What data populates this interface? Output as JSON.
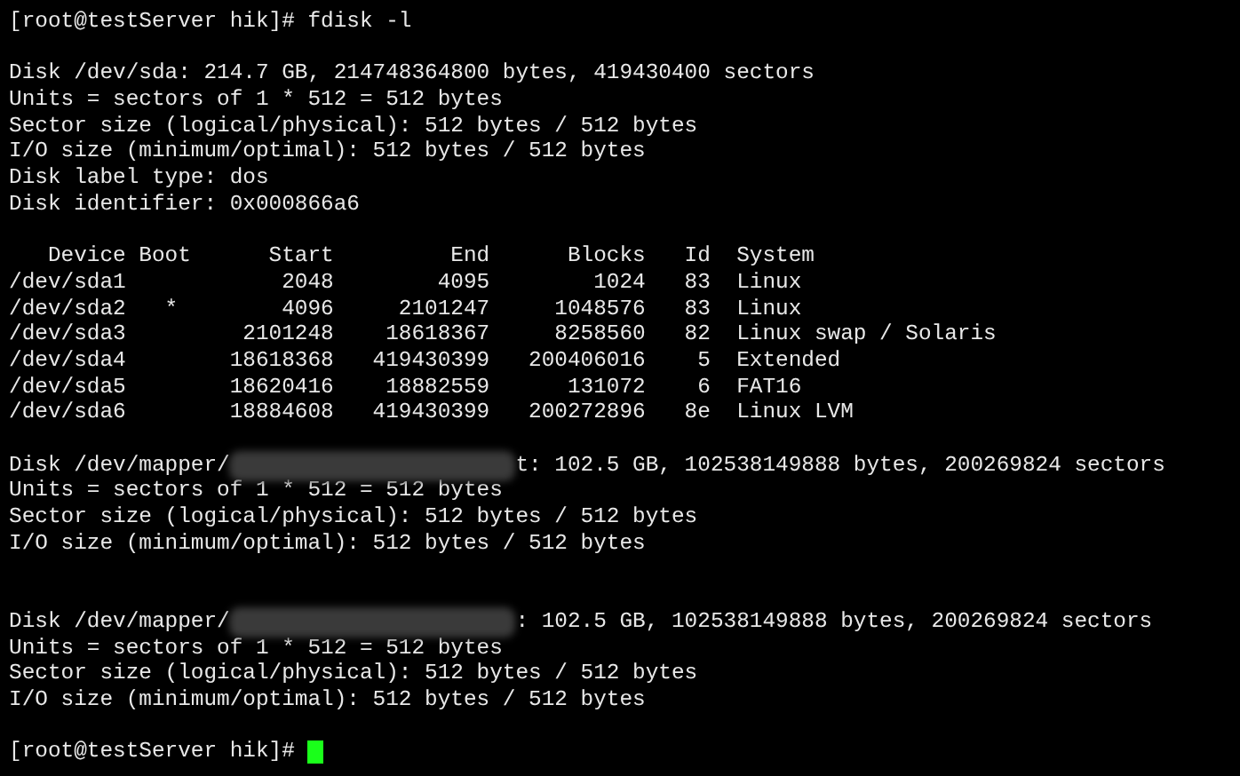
{
  "terminal": {
    "lines": [
      {
        "kind": "prompt",
        "prompt": "[root@testServer hik]#",
        "command": "fdisk -l"
      },
      {
        "kind": "blank"
      },
      {
        "kind": "text",
        "text": "Disk /dev/sda: 214.7 GB, 214748364800 bytes, 419430400 sectors"
      },
      {
        "kind": "text",
        "text": "Units = sectors of 1 * 512 = 512 bytes"
      },
      {
        "kind": "text",
        "text": "Sector size (logical/physical): 512 bytes / 512 bytes"
      },
      {
        "kind": "text",
        "text": "I/O size (minimum/optimal): 512 bytes / 512 bytes"
      },
      {
        "kind": "text",
        "text": "Disk label type: dos"
      },
      {
        "kind": "text",
        "text": "Disk identifier: 0x000866a6"
      },
      {
        "kind": "blank"
      },
      {
        "kind": "text",
        "text": "   Device Boot      Start         End      Blocks   Id  System"
      },
      {
        "kind": "text",
        "text": "/dev/sda1            2048        4095        1024   83  Linux"
      },
      {
        "kind": "text",
        "text": "/dev/sda2   *        4096     2101247     1048576   83  Linux"
      },
      {
        "kind": "text",
        "text": "/dev/sda3         2101248    18618367     8258560   82  Linux swap / Solaris"
      },
      {
        "kind": "text",
        "text": "/dev/sda4        18618368   419430399   200406016    5  Extended"
      },
      {
        "kind": "text",
        "text": "/dev/sda5        18620416    18882559      131072    6  FAT16"
      },
      {
        "kind": "text",
        "text": "/dev/sda6        18884608   419430399   200272896   8e  Linux LVM"
      },
      {
        "kind": "blank"
      },
      {
        "kind": "redacted",
        "before": "Disk /dev/mapper/",
        "after": "t: 102.5 GB, 102538149888 bytes, 200269824 sectors"
      },
      {
        "kind": "text",
        "text": "Units = sectors of 1 * 512 = 512 bytes"
      },
      {
        "kind": "text",
        "text": "Sector size (logical/physical): 512 bytes / 512 bytes"
      },
      {
        "kind": "text",
        "text": "I/O size (minimum/optimal): 512 bytes / 512 bytes"
      },
      {
        "kind": "blank"
      },
      {
        "kind": "blank"
      },
      {
        "kind": "redacted",
        "before": "Disk /dev/mapper/",
        "after": ": 102.5 GB, 102538149888 bytes, 200269824 sectors"
      },
      {
        "kind": "text",
        "text": "Units = sectors of 1 * 512 = 512 bytes"
      },
      {
        "kind": "text",
        "text": "Sector size (logical/physical): 512 bytes / 512 bytes"
      },
      {
        "kind": "text",
        "text": "I/O size (minimum/optimal): 512 bytes / 512 bytes"
      },
      {
        "kind": "blank"
      },
      {
        "kind": "prompt",
        "prompt": "[root@testServer hik]#",
        "cursor": true
      }
    ]
  }
}
